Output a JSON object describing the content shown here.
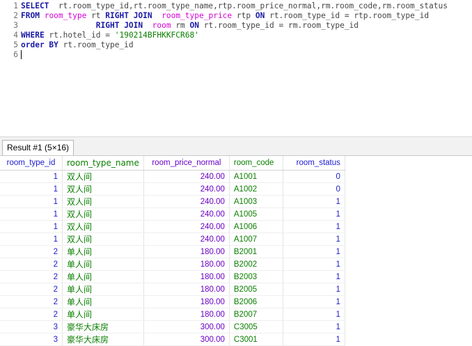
{
  "editor": {
    "lines": [
      {
        "num": "1",
        "parts": [
          {
            "t": "SELECT",
            "c": "kw"
          },
          {
            "t": "  rt.room_type_id,rt.room_type_name,rtp.room_price_normal,rm.room_code,rm.room_status",
            "c": "id"
          }
        ]
      },
      {
        "num": "2",
        "parts": [
          {
            "t": "FROM",
            "c": "kw"
          },
          {
            "t": " ",
            "c": "id"
          },
          {
            "t": "room_type",
            "c": "tb"
          },
          {
            "t": " rt ",
            "c": "id"
          },
          {
            "t": "RIGHT JOIN",
            "c": "kw"
          },
          {
            "t": "  ",
            "c": "id"
          },
          {
            "t": "room_type_price",
            "c": "tb"
          },
          {
            "t": " rtp ",
            "c": "id"
          },
          {
            "t": "ON",
            "c": "kw"
          },
          {
            "t": " rt.room_type_id = rtp.room_type_id",
            "c": "id"
          }
        ]
      },
      {
        "num": "3",
        "parts": [
          {
            "t": "                ",
            "c": "id"
          },
          {
            "t": "RIGHT JOIN",
            "c": "kw"
          },
          {
            "t": "  ",
            "c": "id"
          },
          {
            "t": "room",
            "c": "tb"
          },
          {
            "t": " rm ",
            "c": "id"
          },
          {
            "t": "ON",
            "c": "kw"
          },
          {
            "t": " rt.room_type_id = rm.room_type_id",
            "c": "id"
          }
        ]
      },
      {
        "num": "4",
        "parts": [
          {
            "t": "WHERE",
            "c": "kw"
          },
          {
            "t": " rt.hotel_id = ",
            "c": "id"
          },
          {
            "t": "'190214BFHKKFCR68'",
            "c": "st"
          }
        ]
      },
      {
        "num": "5",
        "parts": [
          {
            "t": "order BY",
            "c": "kw"
          },
          {
            "t": " rt.room_type_id",
            "c": "id"
          }
        ]
      },
      {
        "num": "6",
        "parts": []
      }
    ]
  },
  "result_tab": {
    "label": "Result #1 (5×16)"
  },
  "grid": {
    "columns": [
      "room_type_id",
      "room_type_name",
      "room_price_normal",
      "room_code",
      "room_status"
    ],
    "rows": [
      [
        "1",
        "双人间",
        "240.00",
        "A1001",
        "0"
      ],
      [
        "1",
        "双人间",
        "240.00",
        "A1002",
        "0"
      ],
      [
        "1",
        "双人间",
        "240.00",
        "A1003",
        "1"
      ],
      [
        "1",
        "双人间",
        "240.00",
        "A1005",
        "1"
      ],
      [
        "1",
        "双人间",
        "240.00",
        "A1006",
        "1"
      ],
      [
        "1",
        "双人间",
        "240.00",
        "A1007",
        "1"
      ],
      [
        "2",
        "单人间",
        "180.00",
        "B2001",
        "1"
      ],
      [
        "2",
        "单人间",
        "180.00",
        "B2002",
        "1"
      ],
      [
        "2",
        "单人间",
        "180.00",
        "B2003",
        "1"
      ],
      [
        "2",
        "单人间",
        "180.00",
        "B2005",
        "1"
      ],
      [
        "2",
        "单人间",
        "180.00",
        "B2006",
        "1"
      ],
      [
        "2",
        "单人间",
        "180.00",
        "B2007",
        "1"
      ],
      [
        "3",
        "豪华大床房",
        "300.00",
        "C3005",
        "1"
      ],
      [
        "3",
        "豪华大床房",
        "300.00",
        "C3001",
        "1"
      ]
    ]
  }
}
